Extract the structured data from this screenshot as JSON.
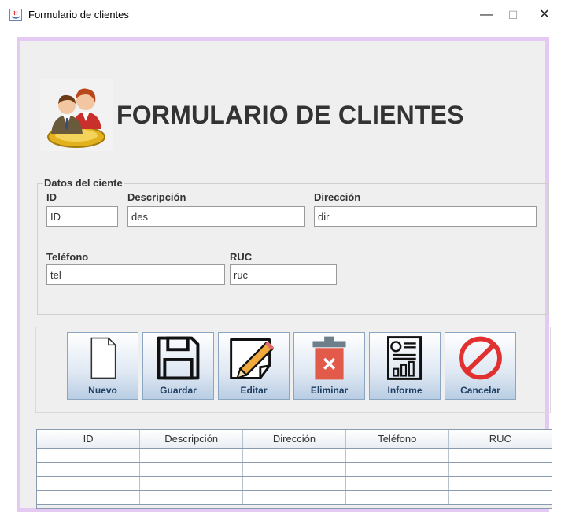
{
  "window": {
    "title": "Formulario de clientes",
    "minimize": "—",
    "maximize": "☐",
    "close": "✕"
  },
  "header": {
    "title": "FORMULARIO DE CLIENTES"
  },
  "form": {
    "group_label": "Datos del ciente",
    "id": {
      "label": "ID",
      "value": "ID"
    },
    "descripcion": {
      "label": "Descripción",
      "value": "des"
    },
    "direccion": {
      "label": "Dirección",
      "value": "dir"
    },
    "telefono": {
      "label": "Teléfono",
      "value": "tel"
    },
    "ruc": {
      "label": "RUC",
      "value": "ruc"
    }
  },
  "toolbar": {
    "nuevo": "Nuevo",
    "guardar": "Guardar",
    "editar": "Editar",
    "eliminar": "Eliminar",
    "informe": "Informe",
    "cancelar": "Cancelar"
  },
  "table": {
    "columns": [
      "ID",
      "Descripción",
      "Dirección",
      "Teléfono",
      "RUC"
    ]
  },
  "colors": {
    "accent_border": "#e4c9f2",
    "button_text": "#1f3f63",
    "delete_red": "#e25a4a",
    "cancel_red": "#e03030"
  }
}
